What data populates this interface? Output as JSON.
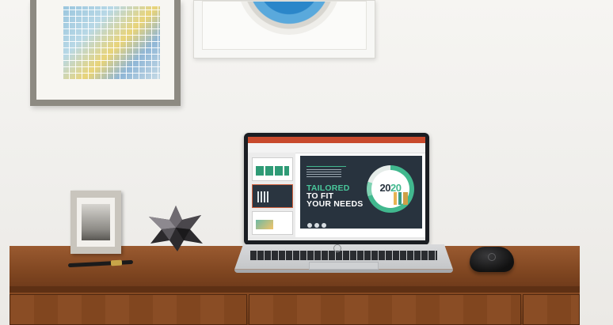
{
  "scene": {
    "laptop_slide": {
      "headline_accent": "TAILORED",
      "headline_line2": "TO FIT",
      "headline_line3": "YOUR NEEDS",
      "badge_year_part1": "20",
      "badge_year_part2": "20"
    }
  },
  "colors": {
    "desk": "#7e4520",
    "wall": "#f3f2ef",
    "slide_bg": "#28333e",
    "slide_accent": "#41b88e",
    "app_ribbon": "#c84a2d"
  }
}
